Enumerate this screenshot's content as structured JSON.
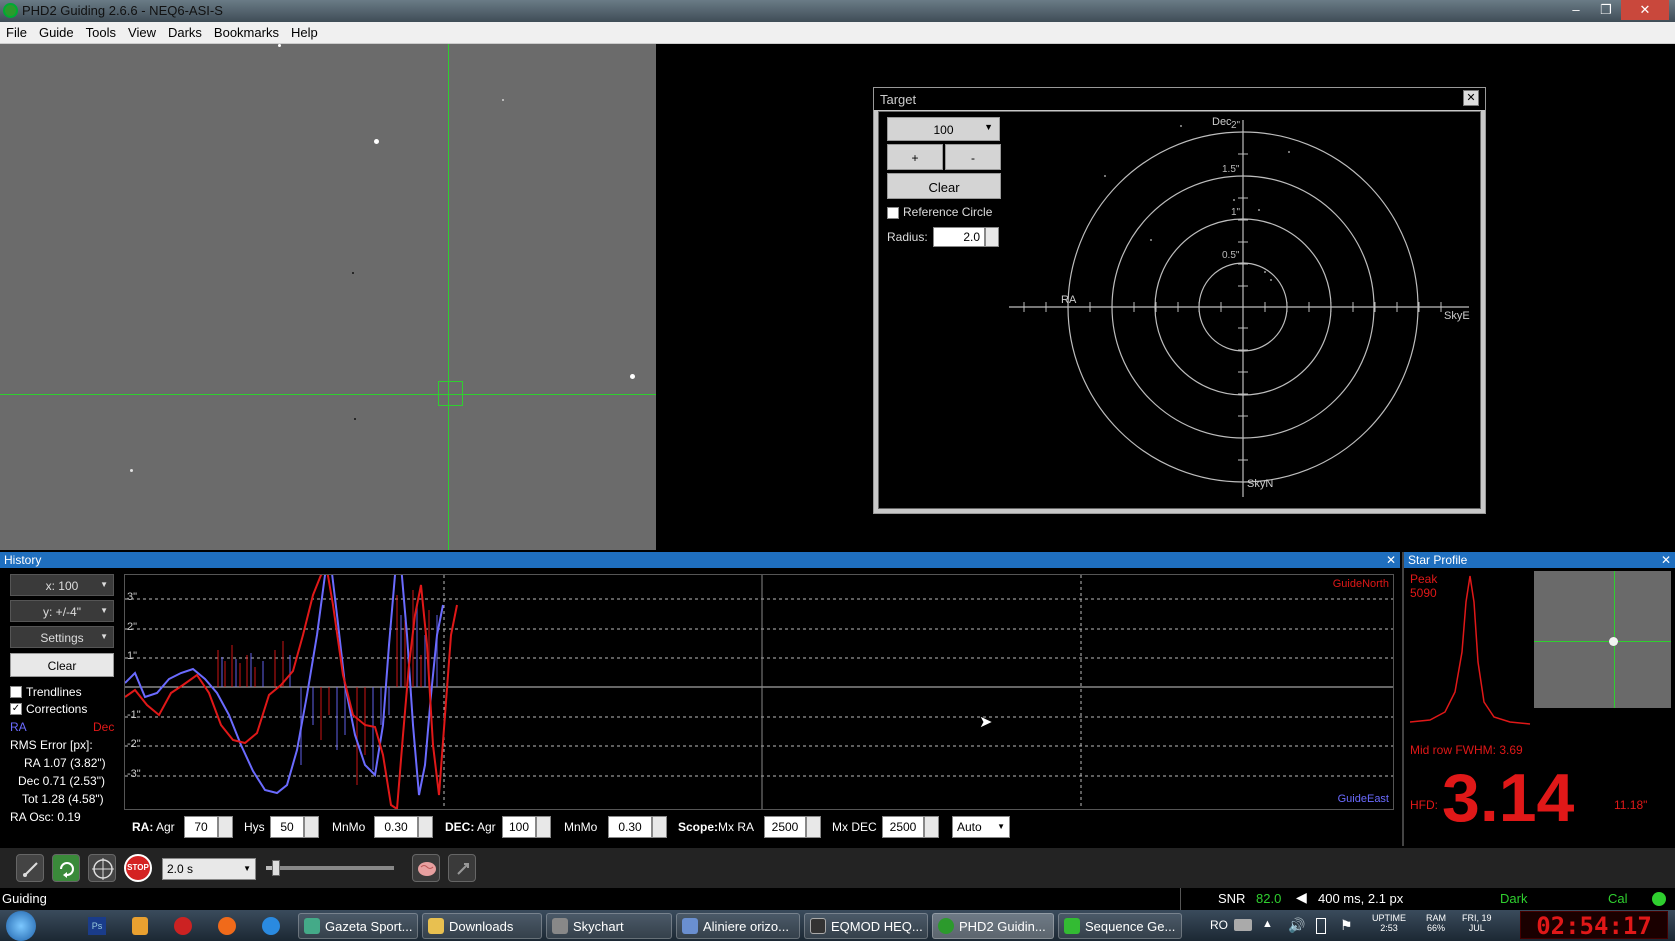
{
  "window": {
    "title": "PHD2 Guiding 2.6.6 - NEQ6-ASI-S",
    "min_glyph": "–",
    "max_glyph": "❐",
    "close_glyph": "✕"
  },
  "menu": [
    "File",
    "Guide",
    "Tools",
    "View",
    "Darks",
    "Bookmarks",
    "Help"
  ],
  "target": {
    "title": "Target",
    "close_glyph": "✕",
    "scale": "100",
    "plus": "+",
    "minus": "-",
    "clear": "Clear",
    "reference_circle_label": "Reference Circle",
    "reference_circle_checked": false,
    "radius_label": "Radius:",
    "radius_value": "2.0",
    "labels": {
      "dec": "Dec",
      "ra": "RA",
      "skye": "SkyE",
      "skyn": "SkyN"
    },
    "rings": [
      "2\"",
      "1.5\"",
      "1\"",
      "0.5\""
    ]
  },
  "history": {
    "title": "History",
    "close_glyph": "✕",
    "x_scale": "x: 100",
    "y_scale": "y: +/-4\"",
    "settings": "Settings",
    "clear": "Clear",
    "trendlines_label": "Trendlines",
    "trendlines_checked": false,
    "corrections_label": "Corrections",
    "corrections_checked": true,
    "legend_ra": "RA",
    "legend_dec": "Dec",
    "rms_title": "RMS Error [px]:",
    "rms_ra": "RA 1.07 (3.82\")",
    "rms_dec": "Dec 0.71 (2.53\")",
    "rms_tot": "Tot 1.28 (4.58\")",
    "ra_osc": "RA Osc: 0.19",
    "y_ticks": [
      "3\"",
      "2\"",
      "1\"",
      "-1\"",
      "-2\"",
      "-3\""
    ],
    "guide_north": "GuideNorth",
    "guide_east": "GuideEast",
    "colors": {
      "ra": "#6b6bff",
      "dec": "#e01818"
    }
  },
  "controls": {
    "ra_label": "RA:",
    "ra_agr_label": "Agr",
    "ra_agr": "70",
    "hys_label": "Hys",
    "hys": "50",
    "mnmo_label": "MnMo",
    "ra_mnmo": "0.30",
    "dec_label": "DEC:",
    "dec_agr_label": "Agr",
    "dec_agr": "100",
    "dec_mnmo": "0.30",
    "scope_label": "Scope:",
    "mx_ra_label": "Mx RA",
    "mx_ra": "2500",
    "mx_dec_label": "Mx DEC",
    "mx_dec": "2500",
    "mode": "Auto"
  },
  "star_profile": {
    "title": "Star Profile",
    "close_glyph": "✕",
    "peak_label": "Peak",
    "peak_value": "5090",
    "fwhm": "Mid row FWHM: 3.69",
    "hfd_label": "HFD:",
    "hfd_value": "3.14",
    "hfd_arcsec": "11.18\""
  },
  "toolbar": {
    "exposure": "2.0 s",
    "stop_label": "STOP",
    "slider_level": 0.05
  },
  "status": {
    "left": "Guiding",
    "snr_label": "SNR",
    "snr_value": "82.0",
    "last_guide": "400 ms, 2.1 px",
    "dark": "Dark",
    "cal": "Cal"
  },
  "taskbar": {
    "items": [
      "Gazeta Sport...",
      "Downloads",
      "Skychart",
      "Aliniere orizo...",
      "EQMOD HEQ...",
      "PHD2 Guidin...",
      "Sequence Ge..."
    ],
    "lang": "RO",
    "uptime_label": "UPTIME",
    "uptime": "2:53",
    "ram_label": "RAM",
    "ram": "66%",
    "date_day": "FRI, 19",
    "date_month": "JUL",
    "clock": "02:54:17"
  }
}
